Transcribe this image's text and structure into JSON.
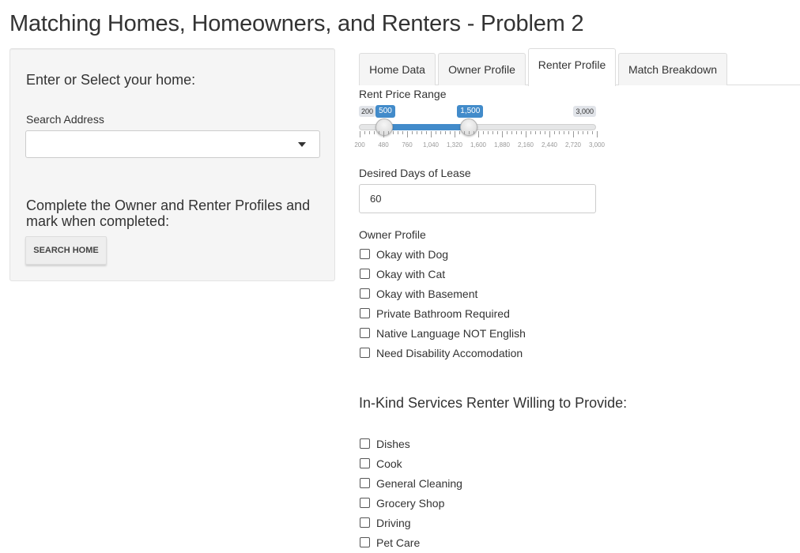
{
  "page": {
    "title": "Matching Homes, Homeowners, and Renters - Problem 2"
  },
  "sidebar": {
    "heading": "Enter or Select your home:",
    "search_label": "Search Address",
    "search_value": "",
    "profiles_heading": "Complete the Owner and Renter Profiles and mark when completed:",
    "search_button": "SEARCH HOME"
  },
  "tabs": [
    {
      "label": "Home Data",
      "active": false
    },
    {
      "label": "Owner Profile",
      "active": false
    },
    {
      "label": "Renter Profile",
      "active": true
    },
    {
      "label": "Match Breakdown",
      "active": false
    }
  ],
  "renter": {
    "rent_range": {
      "label": "Rent Price Range",
      "min": 200,
      "max": 3000,
      "low": 500,
      "high": 1500,
      "min_label": "200",
      "max_label": "3,000",
      "low_label": "500",
      "high_label": "1,500",
      "ticks": [
        "200",
        "480",
        "760",
        "1,040",
        "1,320",
        "1,600",
        "1,880",
        "2,160",
        "2,440",
        "2,720",
        "3,000"
      ]
    },
    "lease": {
      "label": "Desired Days of Lease",
      "value": "60"
    },
    "owner_profile": {
      "label": "Owner Profile",
      "options": [
        {
          "label": "Okay with Dog",
          "checked": false
        },
        {
          "label": "Okay with Cat",
          "checked": false
        },
        {
          "label": "Okay with Basement",
          "checked": false
        },
        {
          "label": "Private Bathroom Required",
          "checked": false
        },
        {
          "label": "Native Language NOT English",
          "checked": false
        },
        {
          "label": "Need Disability Accomodation",
          "checked": false
        }
      ]
    },
    "services": {
      "heading": "In-Kind Services Renter Willing to Provide:",
      "options": [
        {
          "label": "Dishes",
          "checked": false
        },
        {
          "label": "Cook",
          "checked": false
        },
        {
          "label": "General Cleaning",
          "checked": false
        },
        {
          "label": "Grocery Shop",
          "checked": false
        },
        {
          "label": "Driving",
          "checked": false
        },
        {
          "label": "Pet Care",
          "checked": false
        }
      ]
    }
  }
}
